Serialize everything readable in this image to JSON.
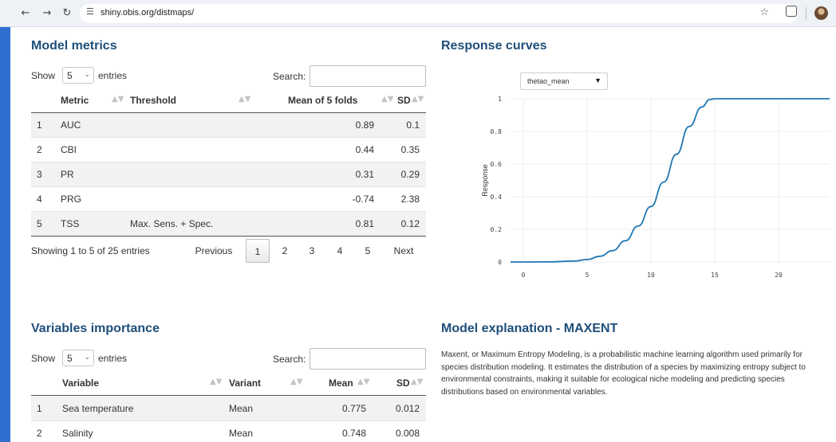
{
  "browser": {
    "url": "shiny.obis.org/distmaps/",
    "icons": [
      "back-icon",
      "forward-icon",
      "reload-icon",
      "site-settings-icon",
      "bookmark-star-icon",
      "extensions-icon",
      "profile-avatar"
    ]
  },
  "metrics": {
    "title": "Model metrics",
    "show_label": "Show",
    "entries_value": "5",
    "entries_label": "entries",
    "search_label": "Search:",
    "search_value": "",
    "columns": [
      "Metric",
      "Threshold",
      "Mean of 5 folds",
      "SD"
    ],
    "rows": [
      {
        "idx": "1",
        "metric": "AUC",
        "threshold": "",
        "mean": "0.89",
        "sd": "0.1"
      },
      {
        "idx": "2",
        "metric": "CBI",
        "threshold": "",
        "mean": "0.44",
        "sd": "0.35"
      },
      {
        "idx": "3",
        "metric": "PR",
        "threshold": "",
        "mean": "0.31",
        "sd": "0.29"
      },
      {
        "idx": "4",
        "metric": "PRG",
        "threshold": "",
        "mean": "-0.74",
        "sd": "2.38"
      },
      {
        "idx": "5",
        "metric": "TSS",
        "threshold": "Max. Sens. + Spec.",
        "mean": "0.81",
        "sd": "0.12"
      }
    ],
    "info": "Showing 1 to 5 of 25 entries",
    "pager": {
      "previous": "Previous",
      "pages": [
        "1",
        "2",
        "3",
        "4",
        "5"
      ],
      "current": "1",
      "next": "Next"
    }
  },
  "response": {
    "title": "Response curves",
    "variable_select": "thetao_mean"
  },
  "variables": {
    "title": "Variables importance",
    "show_label": "Show",
    "entries_value": "5",
    "entries_label": "entries",
    "search_label": "Search:",
    "search_value": "",
    "columns": [
      "Variable",
      "Variant",
      "Mean",
      "SD"
    ],
    "rows": [
      {
        "idx": "1",
        "variable": "Sea temperature",
        "variant": "Mean",
        "mean": "0.775",
        "sd": "0.012"
      },
      {
        "idx": "2",
        "variable": "Salinity",
        "variant": "Mean",
        "mean": "0.748",
        "sd": "0.008"
      }
    ]
  },
  "explanation": {
    "title": "Model explanation - MAXENT",
    "text": "Maxent, or Maximum Entropy Modeling, is a probabilistic machine learning algorithm used primarily for species distribution modeling. It estimates the distribution of a species by maximizing entropy subject to environmental constraints, making it suitable for ecological niche modeling and predicting species distributions based on environmental variables."
  },
  "chart_data": {
    "type": "line",
    "title": "",
    "xlabel": "",
    "ylabel": "Response",
    "xlim": [
      -1,
      24
    ],
    "ylim": [
      0,
      1
    ],
    "x_ticks": [
      "0",
      "5",
      "10",
      "15",
      "20"
    ],
    "y_ticks": [
      "0",
      "0.2",
      "0.4",
      "0.6",
      "0.8",
      "1"
    ],
    "grid": true,
    "color": "#1f77b4",
    "series": [
      {
        "x": [
          -1,
          0,
          2,
          4,
          5,
          6,
          7,
          8,
          9,
          10,
          11,
          12,
          13,
          14,
          14.6,
          15,
          16,
          18,
          20,
          22,
          24
        ],
        "values": [
          0,
          0,
          0.001,
          0.006,
          0.015,
          0.035,
          0.07,
          0.13,
          0.22,
          0.34,
          0.49,
          0.66,
          0.83,
          0.95,
          0.995,
          1,
          1,
          1,
          1,
          1,
          1
        ]
      }
    ]
  }
}
